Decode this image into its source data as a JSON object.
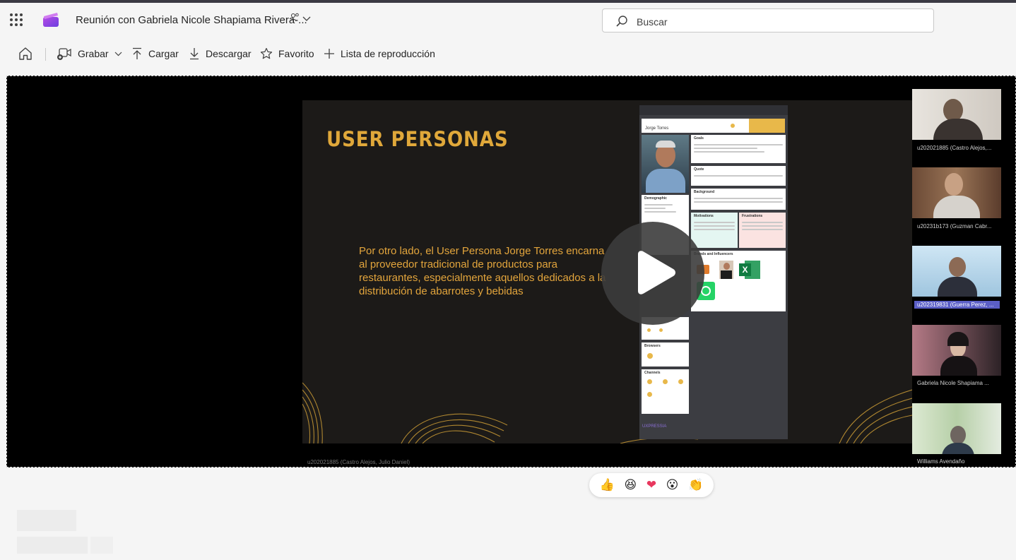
{
  "header": {
    "title": "Reunión con Gabriela Nicole Shapiama Rivera-...",
    "search_placeholder": "Buscar"
  },
  "toolbar": {
    "record_label": "Grabar",
    "upload_label": "Cargar",
    "download_label": "Descargar",
    "favorite_label": "Favorito",
    "playlist_label": "Lista de reproducción"
  },
  "slide": {
    "title": "USER PERSONAS",
    "body": "Por otro lado, el User Persona Jorge Torres encarna al proveedor tradicional de productos para restaurantes, especialmente aquellos dedicados a la distribución de abarrotes y bebidas",
    "persona": {
      "name": "Jorge Torres",
      "sections": {
        "goals": "Goals",
        "quote": "Quote",
        "background": "Background",
        "demographic": "Demographic",
        "motivations": "Motivations",
        "frustrations": "Frustrations",
        "brands": "Brands and Influencers",
        "browsers": "Browsers",
        "channels": "Channels"
      },
      "footer": "UXPRESSIA"
    }
  },
  "video_caption": "u202021885 (Castro Alejos, Julio Daniel)",
  "participants": [
    {
      "label": "u202021885 (Castro Alejos,..."
    },
    {
      "label": "u20231b173 (Guzman Cabr..."
    },
    {
      "label": "u202319831 (Guerra Perez, ..."
    },
    {
      "label": "Gabriela Nicole Shapiama ..."
    },
    {
      "label": "Williams Avendaño"
    }
  ],
  "reactions": [
    "👍",
    "😆",
    "❤",
    "😮",
    "👏"
  ],
  "colors": {
    "accent": "#5b5fc7",
    "slide_text": "#e0a83a",
    "stage_bg": "#000000"
  },
  "icons": [
    "waffle-icon",
    "clipchamp-icon",
    "people-icon",
    "chevron-down-icon",
    "search-icon",
    "home-icon",
    "record-icon",
    "upload-icon",
    "download-icon",
    "star-icon",
    "add-icon",
    "play-icon"
  ]
}
